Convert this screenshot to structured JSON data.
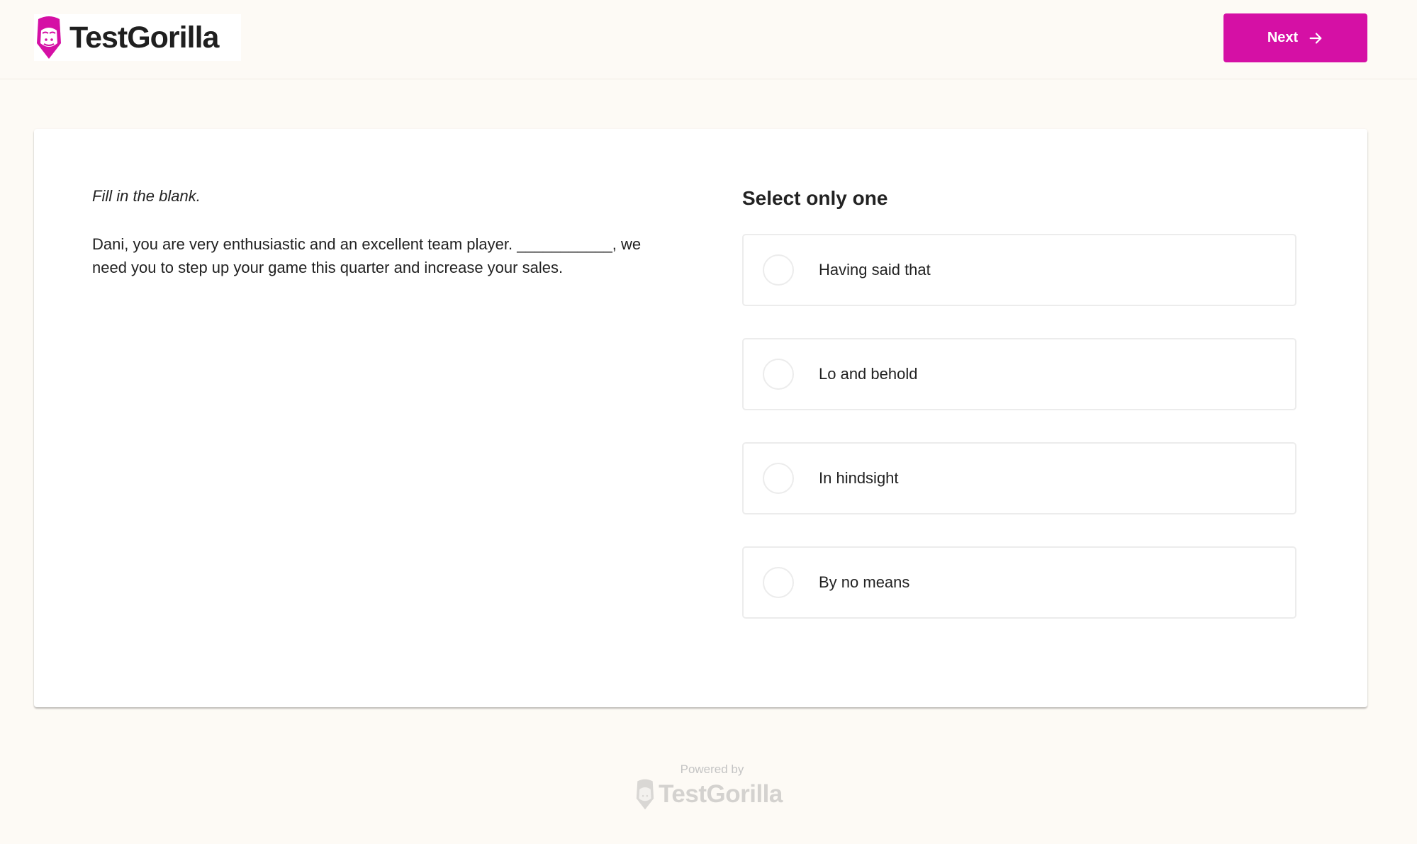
{
  "header": {
    "brand": "TestGorilla",
    "next_label": "Next",
    "brand_color": "#d510a5"
  },
  "question": {
    "instruction": "Fill in the blank.",
    "text": "Dani, you are very enthusiastic and an excellent team player. ___________, we need you to step up your game this quarter and increase your sales."
  },
  "answers": {
    "title": "Select only one",
    "options": [
      {
        "label": "Having said that",
        "selected": false
      },
      {
        "label": "Lo and behold",
        "selected": false
      },
      {
        "label": "In hindsight",
        "selected": false
      },
      {
        "label": "By no means",
        "selected": false
      }
    ]
  },
  "footer": {
    "powered_by": "Powered by",
    "brand": "TestGorilla"
  }
}
